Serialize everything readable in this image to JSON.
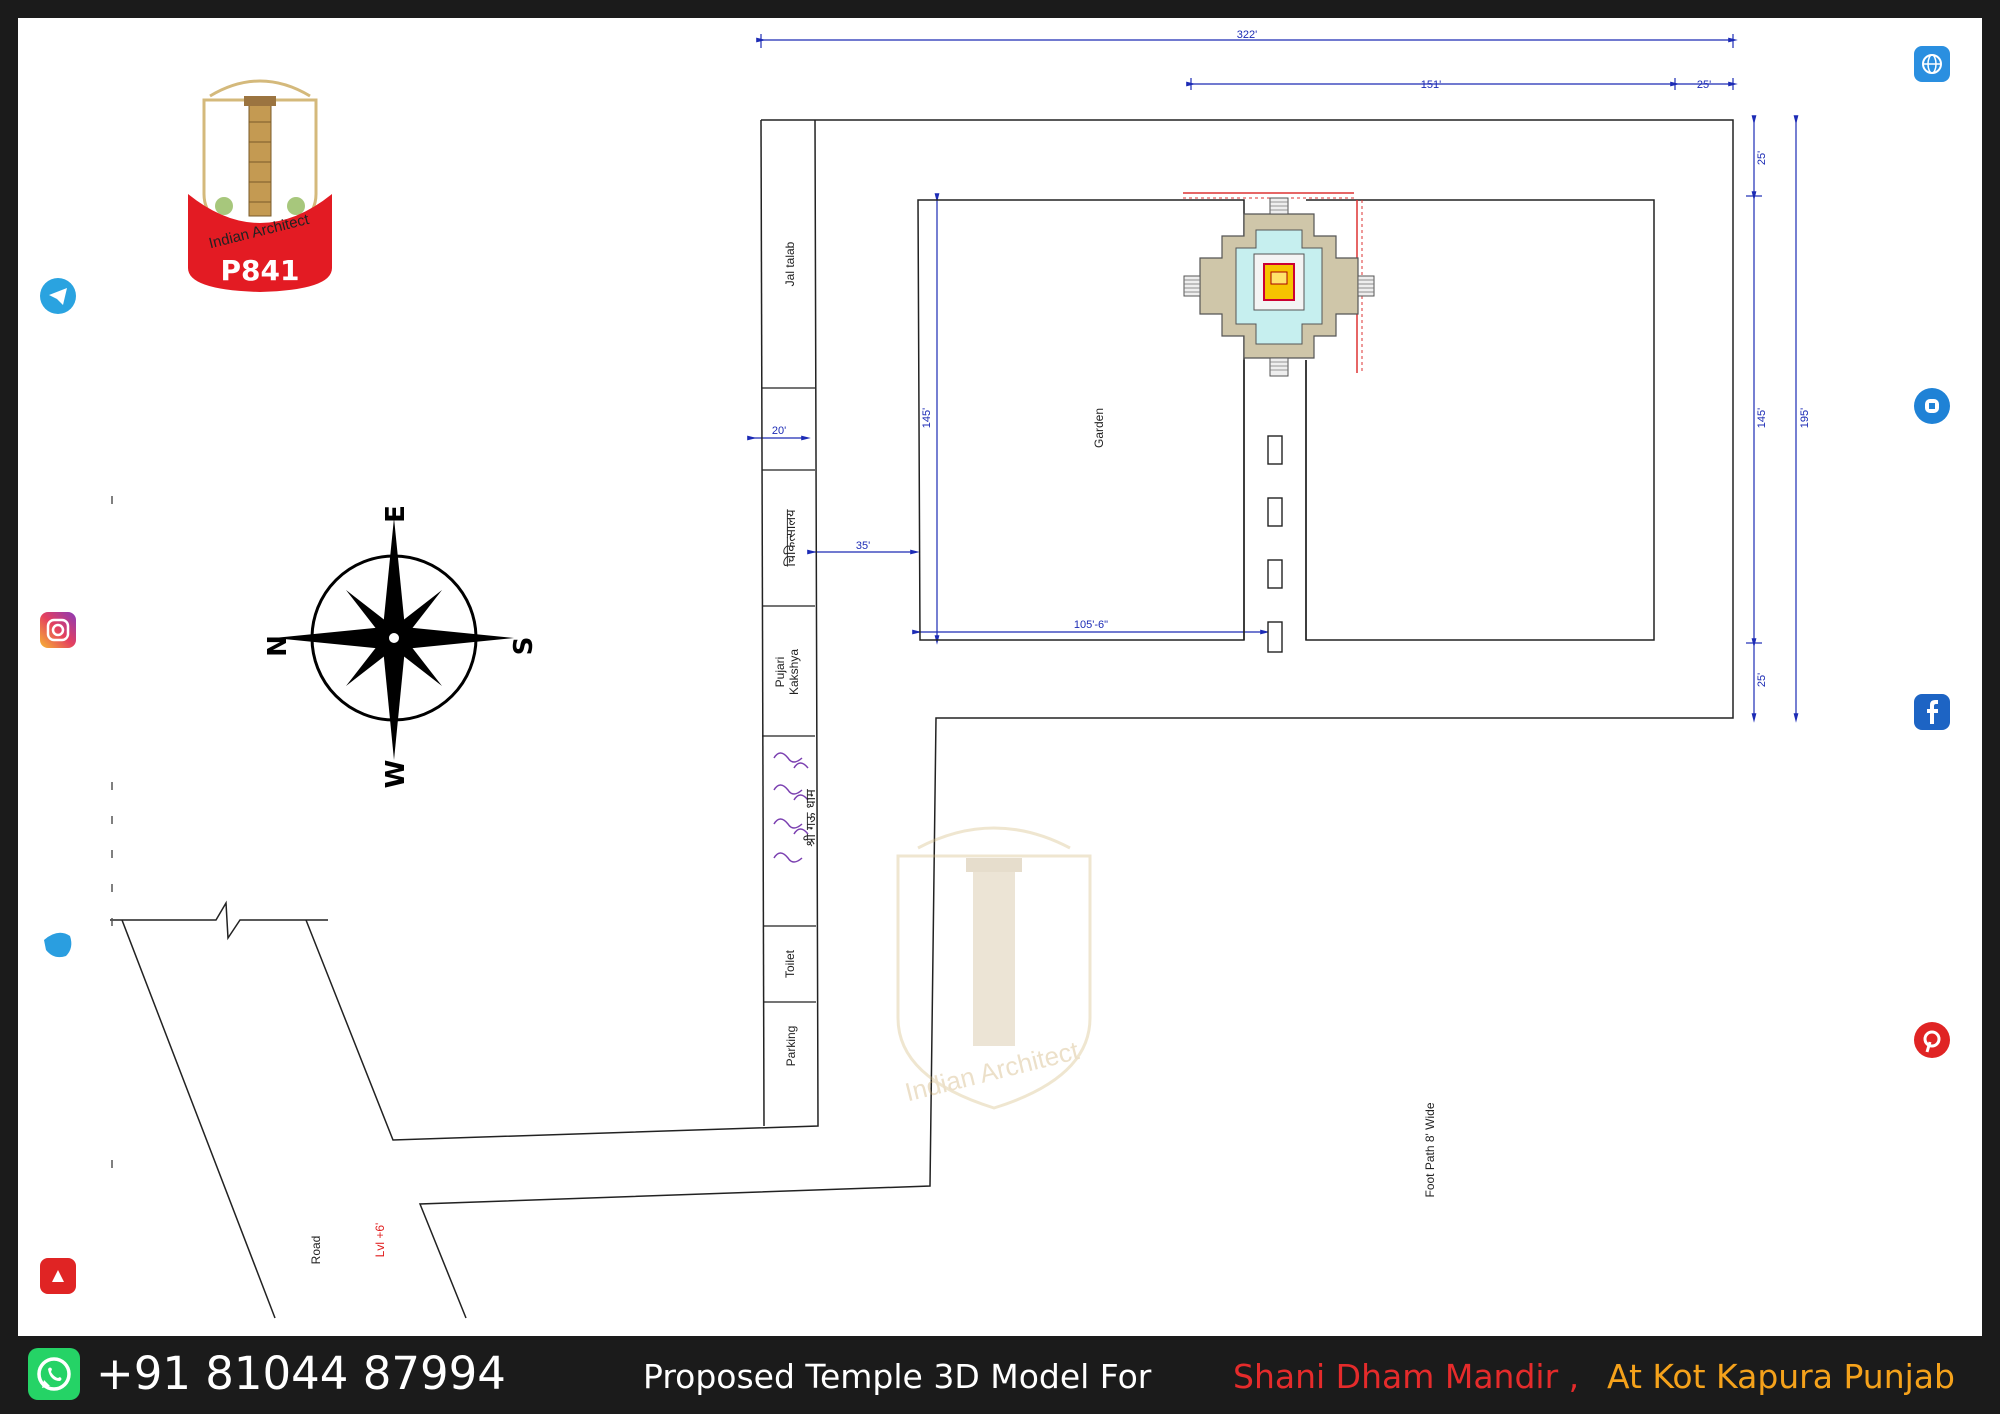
{
  "logo": {
    "brand": "Indian Architect",
    "code": "P841"
  },
  "compass": {
    "north": "N",
    "east": "E",
    "south": "S",
    "west": "W"
  },
  "dimensions": {
    "total_width": "322'",
    "plot_width": "151'",
    "side_setback": "25'",
    "garden_depth": "145'",
    "right_top": "25'",
    "right_mid": "145'",
    "right_bottom": "25'",
    "overall_depth": "195'",
    "strip_width": "20'",
    "gap": "35'",
    "garden_width": "105'-6\""
  },
  "labels": {
    "jal_talab": "Jal talab",
    "chikitsalaya": "चिकित्सालय",
    "pujari_kakshya_1": "Pujari",
    "pujari_kakshya_2": "Kakshya",
    "gaushala": "श्री गऊ धाम",
    "toilet": "Toilet",
    "parking": "Parking",
    "garden": "Garden",
    "foot_path": "Foot Path 8' Wide",
    "road": "Road",
    "level": "Lvl +6'"
  },
  "watermark": {
    "brand": "Indian Architect"
  },
  "footer": {
    "phone": "+91 81044 87994",
    "title": "Proposed Temple 3D Model For",
    "temple": "Shani Dham Mandir ,",
    "location": "At Kot Kapura Punjab"
  },
  "colors": {
    "dimension": "#1c2bb5",
    "red_text": "#e01b1b",
    "orange_text": "#f5a21b",
    "background": "#ffffff",
    "frame": "#1b1b1b"
  },
  "icons": [
    "telegram-icon",
    "instagram-icon",
    "twitter-icon",
    "youtube-icon",
    "globe-icon",
    "skype-icon",
    "facebook-icon",
    "pinterest-icon",
    "whatsapp-icon"
  ]
}
